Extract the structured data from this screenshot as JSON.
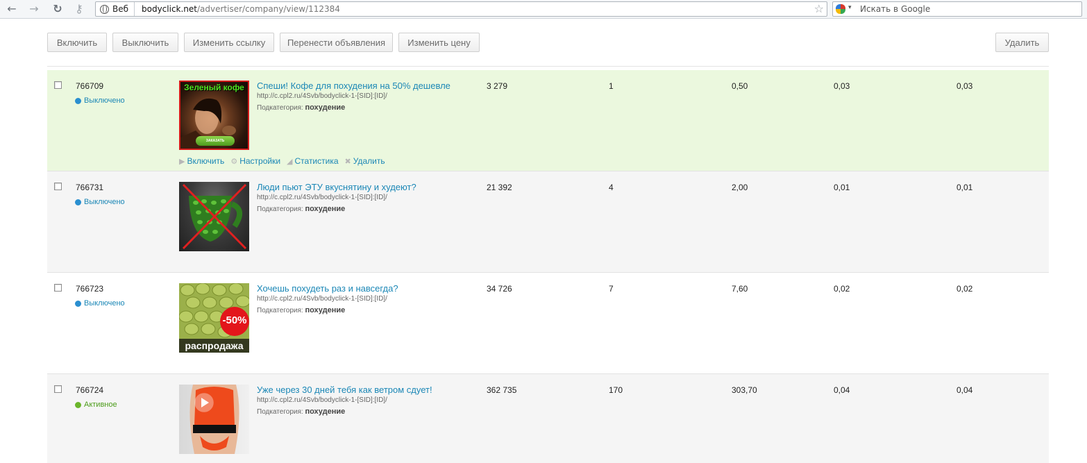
{
  "browser": {
    "back_glyph": "←",
    "forward_glyph": "→",
    "reload_glyph": "↻",
    "key_glyph": "⚷",
    "chip_label": "Веб",
    "url_host": "bodyclick.net",
    "url_path": "/advertiser/company/view/112384",
    "star_glyph": "☆",
    "search_placeholder": "Искать в Google",
    "dropdown_glyph": "▾"
  },
  "toolbar": {
    "enable": "Включить",
    "disable": "Выключить",
    "change_link": "Изменить ссылку",
    "move_ads": "Перенести объявления",
    "change_price": "Изменить цену",
    "delete": "Удалить"
  },
  "colors": {
    "link": "#1b87b6",
    "status_off": "#2a8fd0",
    "status_active": "#6ab52a",
    "row_highlight": "#ebf8de"
  },
  "subcategory_label": "Подкатегория:",
  "row_actions": {
    "enable": "Включить",
    "settings": "Настройки",
    "stats": "Статистика",
    "delete": "Удалить",
    "icons": [
      "play-icon",
      "gear-icon",
      "chart-icon",
      "close-icon"
    ]
  },
  "ads": [
    {
      "id": "766709",
      "status": "Выключено",
      "title": "Спеши! Кофе для похудения на 50% дешевле",
      "link": "http://c.cpl2.ru/4Svb/bodyclick-1-[SID]:[ID]/",
      "subcategory": "похудение",
      "image_caption": "Зеленый кофе",
      "image_button": "ЗАКАЗАТЬ",
      "c1": "3 279",
      "c2": "1",
      "c3": "0,50",
      "c4": "0,03",
      "c5": "0,03"
    },
    {
      "id": "766731",
      "status": "Выключено",
      "title": "Люди пьют ЭТУ вкуснятину и худеют?",
      "link": "http://c.cpl2.ru/4Svb/bodyclick-1-[SID]:[ID]/",
      "subcategory": "похудение",
      "c1": "21 392",
      "c2": "4",
      "c3": "2,00",
      "c4": "0,01",
      "c5": "0,01"
    },
    {
      "id": "766723",
      "status": "Выключено",
      "title": "Хочешь похудеть раз и навсегда?",
      "link": "http://c.cpl2.ru/4Svb/bodyclick-1-[SID]:[ID]/",
      "subcategory": "похудение",
      "image_badge": "-50%",
      "image_caption": "распродажа",
      "c1": "34 726",
      "c2": "7",
      "c3": "7,60",
      "c4": "0,02",
      "c5": "0,02"
    },
    {
      "id": "766724",
      "status": "Активное",
      "title": "Уже через 30 дней тебя как ветром сдует!",
      "link": "http://c.cpl2.ru/4Svb/bodyclick-1-[SID]:[ID]/",
      "subcategory": "похудение",
      "c1": "362 735",
      "c2": "170",
      "c3": "303,70",
      "c4": "0,04",
      "c5": "0,04"
    }
  ]
}
